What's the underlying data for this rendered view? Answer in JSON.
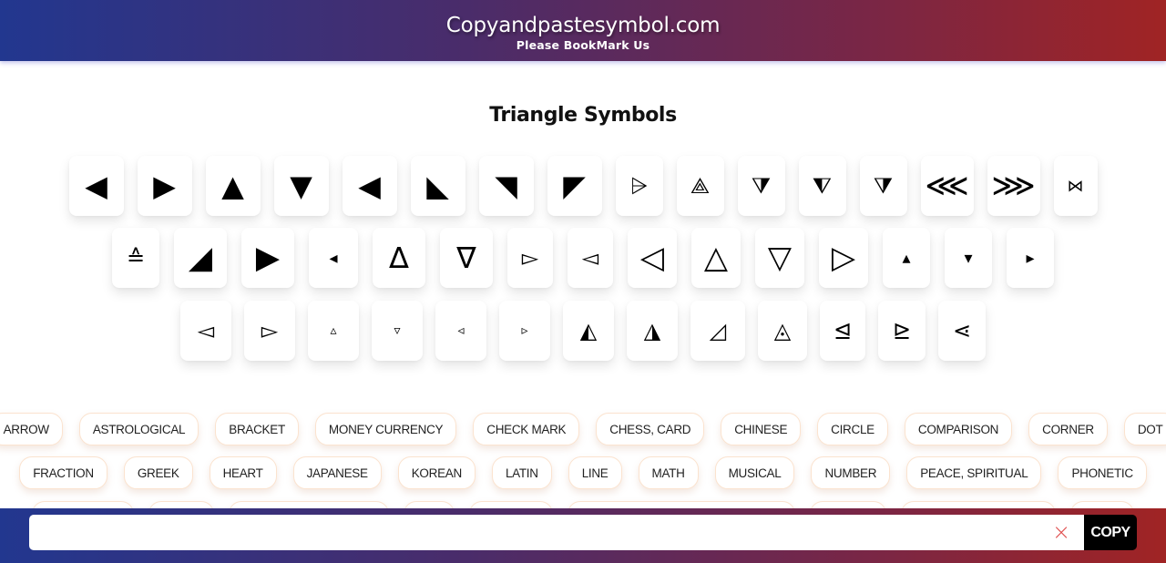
{
  "header": {
    "title": "Copyandpastesymbol.com",
    "subtitle": "Please BookMark Us"
  },
  "page_title": "Triangle Symbols",
  "symbols": {
    "row1": [
      "◀",
      "▶",
      "▲",
      "▼",
      "◀",
      "◣",
      "◥",
      "◤",
      "⩥",
      "⟁",
      "⧩",
      "⧨",
      "⧩",
      "⋘",
      "⋙",
      "⋈"
    ],
    "row2": [
      "≙",
      "◢",
      "▶",
      "◂",
      "∆",
      "∇",
      "▻",
      "◅",
      "◁",
      "△",
      "▽",
      "▷",
      "▴",
      "▾",
      "▸"
    ],
    "row3": [
      "◅",
      "▻",
      "▵",
      "▿",
      "◃",
      "▹",
      "◭",
      "◮",
      "◿",
      "◬",
      "⊴",
      "⊵",
      "⋖"
    ]
  },
  "categories": {
    "row1": [
      "ARROW",
      "ASTROLOGICAL",
      "BRACKET",
      "MONEY CURRENCY",
      "CHECK MARK",
      "CHESS, CARD",
      "CHINESE",
      "CIRCLE",
      "COMPARISON",
      "CORNER",
      "DOT"
    ],
    "row2": [
      "FRACTION",
      "GREEK",
      "HEART",
      "JAPANESE",
      "KOREAN",
      "LATIN",
      "LINE",
      "MATH",
      "MUSICAL",
      "NUMBER",
      "PEACE, SPIRITUAL",
      "PHONETIC"
    ]
  },
  "footer": {
    "input_value": "",
    "input_placeholder": "",
    "clear_icon": "×",
    "copy_label": "COPY"
  },
  "colors": {
    "gradient_start": "#22378f",
    "gradient_end": "#a02424",
    "clear_icon": "#e05252",
    "copy_button": "#000000"
  }
}
